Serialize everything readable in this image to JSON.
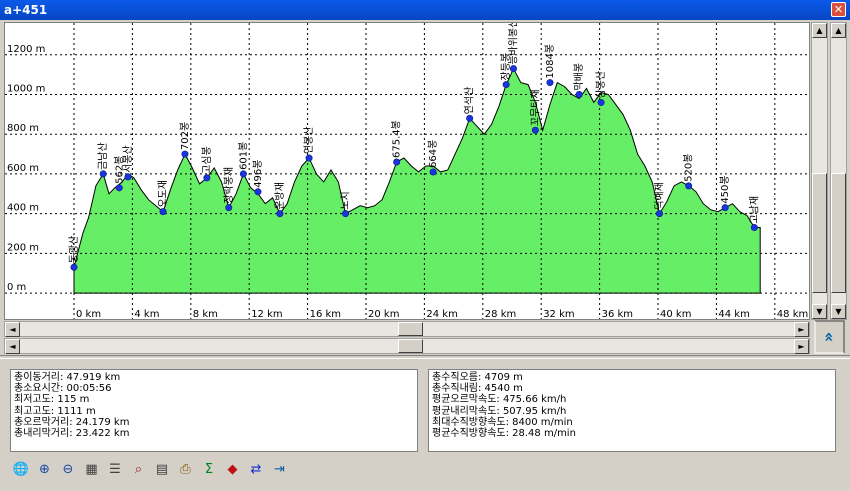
{
  "window": {
    "title": "a+451",
    "close_label": "✕"
  },
  "chart_data": {
    "type": "area",
    "xlim": [
      0,
      50
    ],
    "ylim": [
      -50,
      1350
    ],
    "x_ticks": [
      0,
      4,
      8,
      12,
      16,
      20,
      24,
      28,
      32,
      36,
      40,
      44,
      48
    ],
    "x_tick_labels": [
      "0 km",
      "4 km",
      "8 km",
      "12 km",
      "16 km",
      "20 km",
      "24 km",
      "28 km",
      "32 km",
      "36 km",
      "40 km",
      "44 km",
      "48 km"
    ],
    "y_ticks": [
      0,
      200,
      400,
      600,
      800,
      1000,
      1200
    ],
    "y_tick_labels": [
      "0 m",
      "200 m",
      "400 m",
      "600 m",
      "800 m",
      "1000 m",
      "1200 m"
    ],
    "grid": true,
    "fill_color": "#66ef66",
    "line_color": "#000000",
    "marker_color": "#1a35e0",
    "profile": [
      [
        0,
        130
      ],
      [
        0.6,
        300
      ],
      [
        1.0,
        380
      ],
      [
        1.5,
        540
      ],
      [
        2.0,
        600
      ],
      [
        2.4,
        500
      ],
      [
        2.8,
        530
      ],
      [
        3.3,
        560
      ],
      [
        3.7,
        600
      ],
      [
        4.1,
        580
      ],
      [
        4.6,
        520
      ],
      [
        5.1,
        470
      ],
      [
        5.6,
        440
      ],
      [
        6.1,
        410
      ],
      [
        6.6,
        520
      ],
      [
        7.1,
        620
      ],
      [
        7.6,
        700
      ],
      [
        8.1,
        630
      ],
      [
        8.6,
        550
      ],
      [
        9.1,
        580
      ],
      [
        9.6,
        630
      ],
      [
        10.1,
        560
      ],
      [
        10.6,
        430
      ],
      [
        11.1,
        500
      ],
      [
        11.6,
        600
      ],
      [
        12.1,
        530
      ],
      [
        12.6,
        500
      ],
      [
        13.1,
        450
      ],
      [
        13.6,
        480
      ],
      [
        14.1,
        400
      ],
      [
        14.6,
        450
      ],
      [
        15.1,
        560
      ],
      [
        15.6,
        640
      ],
      [
        16.1,
        680
      ],
      [
        16.6,
        600
      ],
      [
        17.1,
        560
      ],
      [
        17.6,
        620
      ],
      [
        18.1,
        560
      ],
      [
        18.6,
        400
      ],
      [
        19.1,
        420
      ],
      [
        19.6,
        440
      ],
      [
        20.1,
        430
      ],
      [
        20.6,
        440
      ],
      [
        21.1,
        470
      ],
      [
        21.6,
        560
      ],
      [
        22.1,
        660
      ],
      [
        22.6,
        680
      ],
      [
        23.1,
        640
      ],
      [
        23.6,
        610
      ],
      [
        24.1,
        640
      ],
      [
        24.6,
        640
      ],
      [
        25.1,
        610
      ],
      [
        25.6,
        620
      ],
      [
        26.1,
        700
      ],
      [
        26.6,
        780
      ],
      [
        27.1,
        880
      ],
      [
        27.6,
        840
      ],
      [
        28.1,
        800
      ],
      [
        28.6,
        850
      ],
      [
        29.1,
        940
      ],
      [
        29.6,
        1050
      ],
      [
        30.1,
        1130
      ],
      [
        30.6,
        1060
      ],
      [
        31.1,
        1050
      ],
      [
        31.6,
        960
      ],
      [
        32.1,
        820
      ],
      [
        32.6,
        950
      ],
      [
        33.1,
        1060
      ],
      [
        33.6,
        1040
      ],
      [
        34.1,
        1000
      ],
      [
        34.6,
        980
      ],
      [
        35.1,
        1030
      ],
      [
        35.6,
        960
      ],
      [
        36.1,
        1010
      ],
      [
        36.6,
        1000
      ],
      [
        37.1,
        950
      ],
      [
        37.6,
        900
      ],
      [
        38.1,
        820
      ],
      [
        38.6,
        700
      ],
      [
        39.1,
        640
      ],
      [
        39.6,
        560
      ],
      [
        40.1,
        400
      ],
      [
        40.6,
        460
      ],
      [
        41.1,
        540
      ],
      [
        41.6,
        560
      ],
      [
        42.1,
        540
      ],
      [
        42.6,
        510
      ],
      [
        43.1,
        450
      ],
      [
        43.6,
        420
      ],
      [
        44.1,
        410
      ],
      [
        44.6,
        430
      ],
      [
        45.1,
        450
      ],
      [
        45.6,
        410
      ],
      [
        46.1,
        390
      ],
      [
        46.6,
        330
      ],
      [
        47.0,
        330
      ],
      [
        47.0,
        0
      ],
      [
        0,
        0
      ]
    ],
    "points": [
      {
        "x": 0.0,
        "y": 130,
        "label": "동광산"
      },
      {
        "x": 2.0,
        "y": 600,
        "label": "금남산"
      },
      {
        "x": 3.1,
        "y": 530,
        "label": "562봉"
      },
      {
        "x": 3.7,
        "y": 585,
        "label": "서봉산"
      },
      {
        "x": 6.1,
        "y": 410,
        "label": "오도재"
      },
      {
        "x": 7.6,
        "y": 700,
        "label": "702봉"
      },
      {
        "x": 9.1,
        "y": 580,
        "label": "고심봉"
      },
      {
        "x": 10.6,
        "y": 430,
        "label": "장락봉재"
      },
      {
        "x": 11.6,
        "y": 600,
        "label": "601봉"
      },
      {
        "x": 12.6,
        "y": 510,
        "label": "496봉"
      },
      {
        "x": 14.1,
        "y": 400,
        "label": "운방재"
      },
      {
        "x": 16.1,
        "y": 680,
        "label": "연봉산"
      },
      {
        "x": 18.6,
        "y": 400,
        "label": "노치"
      },
      {
        "x": 22.1,
        "y": 660,
        "label": "675.4봉"
      },
      {
        "x": 24.6,
        "y": 610,
        "label": "664봉"
      },
      {
        "x": 27.1,
        "y": 880,
        "label": "연석산"
      },
      {
        "x": 29.6,
        "y": 1050,
        "label": "장등봉"
      },
      {
        "x": 30.1,
        "y": 1130,
        "label": "능바위봉산"
      },
      {
        "x": 31.6,
        "y": 820,
        "label": "꼬무티재"
      },
      {
        "x": 32.6,
        "y": 1060,
        "label": "1084봉"
      },
      {
        "x": 34.6,
        "y": 1000,
        "label": "막배봉"
      },
      {
        "x": 36.1,
        "y": 960,
        "label": "삼봉산"
      },
      {
        "x": 40.1,
        "y": 400,
        "label": "덕예제"
      },
      {
        "x": 42.1,
        "y": 540,
        "label": "520봉"
      },
      {
        "x": 44.6,
        "y": 430,
        "label": "450봉"
      },
      {
        "x": 46.6,
        "y": 330,
        "label": "고남재"
      }
    ]
  },
  "stats_left": [
    "총이동거리: 47.919 km",
    "총소요시간: 00:05:56",
    "최저고도: 115 m",
    "최고고도: 1111 m",
    "총오르막거리: 24.179 km",
    "총내리막거리: 23.422 km"
  ],
  "stats_right": [
    "총수직오름: 4709 m",
    "총수직내림: 4540 m",
    "평균오르막속도: 475.66 km/h",
    "평균내리막속도: 507.95 km/h",
    "최대수직방향속도: 8400 m/min",
    "평균수직방향속도: 28.48 m/min"
  ],
  "scroll": {
    "up": "▲",
    "down": "▼",
    "left": "◄",
    "right": "►",
    "collapse": "»"
  },
  "toolbar": [
    {
      "name": "globe-icon",
      "glyph": "🌐",
      "color": "#2a7a2a"
    },
    {
      "name": "zoom-in-icon",
      "glyph": "⊕",
      "color": "#1a4aa0"
    },
    {
      "name": "zoom-out-icon",
      "glyph": "⊖",
      "color": "#1a4aa0"
    },
    {
      "name": "grid-icon",
      "glyph": "▦",
      "color": "#404040"
    },
    {
      "name": "list-settings-icon",
      "glyph": "☰",
      "color": "#404040"
    },
    {
      "name": "find-icon",
      "glyph": "⌕",
      "color": "#a02020"
    },
    {
      "name": "document-icon",
      "glyph": "▤",
      "color": "#404040"
    },
    {
      "name": "print-icon",
      "glyph": "⎙",
      "color": "#806000"
    },
    {
      "name": "sum-icon",
      "glyph": "Σ",
      "color": "#008020"
    },
    {
      "name": "bookmark-icon",
      "glyph": "◆",
      "color": "#c01010"
    },
    {
      "name": "swap-icon",
      "glyph": "⇄",
      "color": "#1030d0"
    },
    {
      "name": "exit-icon",
      "glyph": "⇥",
      "color": "#1060a0"
    }
  ]
}
